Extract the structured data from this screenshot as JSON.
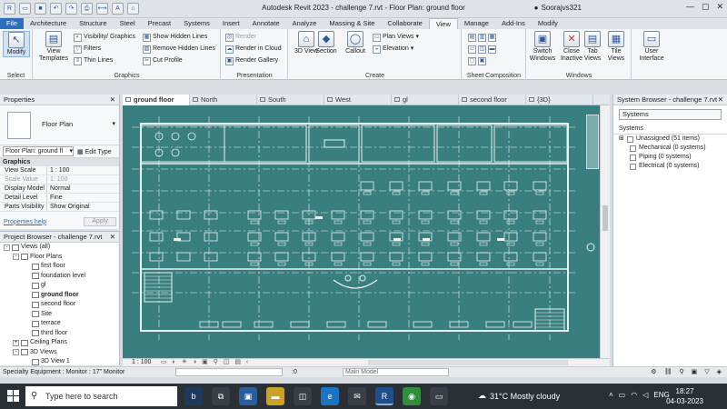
{
  "window": {
    "title": "Autodesk Revit 2023 - challenge 7.rvt - Floor Plan: ground floor",
    "user": "Soorajvs321"
  },
  "ribbon_tabs": [
    "File",
    "Architecture",
    "Structure",
    "Steel",
    "Precast",
    "Systems",
    "Insert",
    "Annotate",
    "Analyze",
    "Massing & Site",
    "Collaborate",
    "View",
    "Manage",
    "Add-Ins",
    "Modify"
  ],
  "ribbon_active_tab": "View",
  "ribbon": {
    "select": {
      "modify": "Modify",
      "label": "Select"
    },
    "graphics": {
      "view_templates": "View Templates",
      "visibility": "Visibility/ Graphics",
      "filters": "Filters",
      "thin_lines": "Thin Lines",
      "show_hidden": "Show Hidden Lines",
      "remove_hidden": "Remove Hidden Lines",
      "cut_profile": "Cut Profile",
      "label": "Graphics"
    },
    "presentation": {
      "render": "Render",
      "render_cloud": "Render in Cloud",
      "render_gallery": "Render Gallery",
      "label": "Presentation"
    },
    "create": {
      "view3d": "3D View",
      "section": "Section",
      "callout": "Callout",
      "plan_views": "Plan Views",
      "elevation": "Elevation",
      "label": "Create"
    },
    "sheet_composition": {
      "label": "Sheet Composition"
    },
    "windows": {
      "switch": "Switch Windows",
      "close_inactive": "Close Inactive",
      "tab_views": "Tab Views",
      "tile_views": "Tile Views",
      "label": "Windows"
    },
    "user_interface": "User Interface"
  },
  "properties": {
    "title": "Properties",
    "type_name": "Floor Plan",
    "instance": "Floor Plan: ground fl",
    "edit_type": "Edit Type",
    "section": "Graphics",
    "rows": [
      {
        "key": "View Scale",
        "value": "1 : 100"
      },
      {
        "key": "Scale Value",
        "value": "1:  100"
      },
      {
        "key": "Display Model",
        "value": "Normal"
      },
      {
        "key": "Detail Level",
        "value": "Fine"
      },
      {
        "key": "Parts Visibility",
        "value": "Show Original"
      }
    ],
    "help": "Properties help",
    "apply": "Apply"
  },
  "project_browser": {
    "title": "Project Browser - challenge 7.rvt",
    "nodes": [
      {
        "label": "Views (all)",
        "level": 0,
        "exp": "-"
      },
      {
        "label": "Floor Plans",
        "level": 1,
        "exp": "-"
      },
      {
        "label": "first floor",
        "level": 2
      },
      {
        "label": "foundation level",
        "level": 2
      },
      {
        "label": "gl",
        "level": 2
      },
      {
        "label": "ground floor",
        "level": 2,
        "bold": true
      },
      {
        "label": "second floor",
        "level": 2
      },
      {
        "label": "Site",
        "level": 2
      },
      {
        "label": "terrace",
        "level": 2
      },
      {
        "label": "third floor",
        "level": 2
      },
      {
        "label": "Ceiling Plans",
        "level": 1,
        "exp": "+"
      },
      {
        "label": "3D Views",
        "level": 1,
        "exp": "-"
      },
      {
        "label": "3D View 1",
        "level": 2
      }
    ]
  },
  "view_tabs": [
    "ground floor",
    "North",
    "South",
    "West",
    "gl",
    "second floor",
    "{3D}"
  ],
  "view_control": {
    "scale": "1 : 100"
  },
  "system_browser": {
    "title": "System Browser - challenge 7.rvt",
    "selector": "Systems",
    "column": "Systems",
    "rows": [
      "Unassigned (51 items)",
      "Mechanical (0 systems)",
      "Piping (0 systems)",
      "Electrical (0 systems)"
    ]
  },
  "status": {
    "text": "Specialty Equipment : Monitor : 17\" Monitor",
    "zero": ":0",
    "model": "Main Model"
  },
  "taskbar": {
    "search_placeholder": "Type here to search",
    "weather": "31°C  Mostly cloudy",
    "lang": "ENG",
    "time": "18:27",
    "date": "04-03-2023"
  },
  "colors": {
    "canvas": "#3a7f80",
    "accent": "#2d6fbd"
  }
}
